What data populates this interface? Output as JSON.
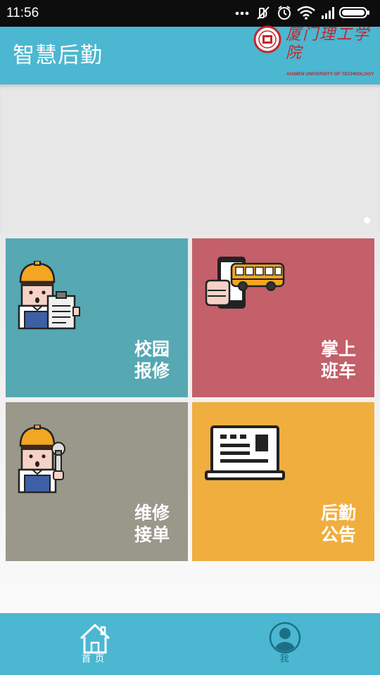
{
  "status_bar": {
    "time": "11:56",
    "icons": [
      "more-dots-icon",
      "mute-icon",
      "alarm-icon",
      "wifi-icon",
      "signal-icon",
      "battery-icon"
    ]
  },
  "header": {
    "title": "智慧后勤",
    "school_name_cn": "厦门理工学院",
    "school_name_en": "XIAMEN UNIVERSITY OF TECHNOLOGY",
    "background": "#4bb7d1"
  },
  "banner": {
    "indicator_count": 1,
    "active_index": 0
  },
  "tiles": [
    {
      "id": "campus-repair",
      "line1": "校园",
      "line2": "报修",
      "color": "#56a8b3",
      "icon": "worker-clipboard-icon"
    },
    {
      "id": "mobile-bus",
      "line1": "掌上",
      "line2": "班车",
      "color": "#c3606a",
      "icon": "phone-bus-icon"
    },
    {
      "id": "repair-orders",
      "line1": "维修",
      "line2": "接单",
      "color": "#9a978b",
      "icon": "worker-wrench-icon"
    },
    {
      "id": "logistics-notice",
      "line1": "后勤",
      "line2": "公告",
      "color": "#f0ae3f",
      "icon": "notice-board-icon"
    }
  ],
  "bottom_nav": {
    "items": [
      {
        "label": "首页",
        "icon": "home-icon",
        "active": true
      },
      {
        "label": "我",
        "icon": "user-avatar-icon",
        "active": false
      }
    ]
  }
}
